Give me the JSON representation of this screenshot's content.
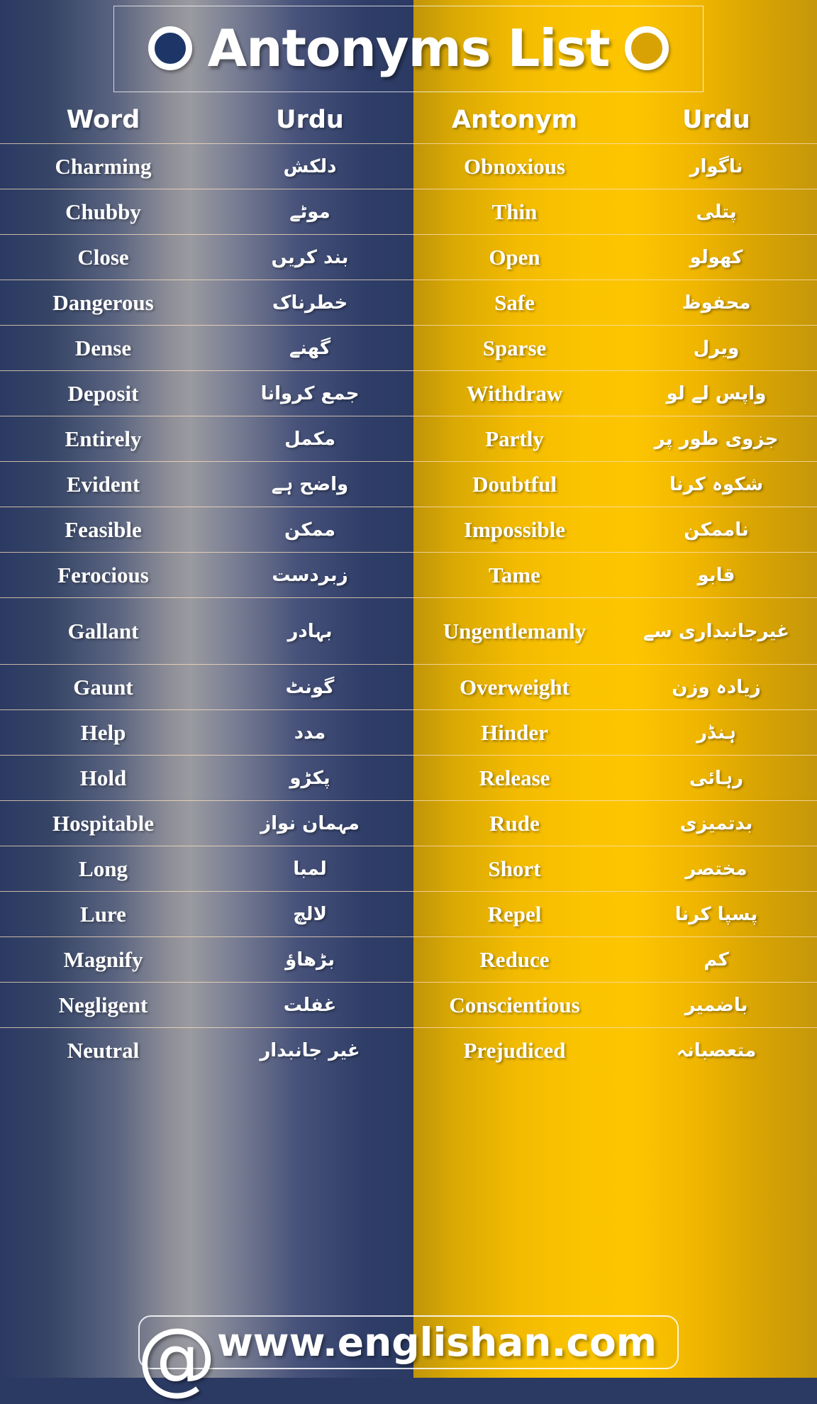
{
  "title": {
    "text": "Antonyms List",
    "left_dot": "circle-icon",
    "right_dot": "circle-icon"
  },
  "colors": {
    "navy": "#2b3a63",
    "navy_light": "#9a9aa0",
    "gold": "#fcc500",
    "gold_dark": "#c1940a",
    "text": "#ffffff",
    "rule": "#ffe1be"
  },
  "table": {
    "headers": [
      "Word",
      "Urdu",
      "Antonym",
      "Urdu"
    ],
    "rows": [
      {
        "word": "Charming",
        "word_urdu": "دلکش",
        "antonym": "Obnoxious",
        "antonym_urdu": "ناگوار"
      },
      {
        "word": "Chubby",
        "word_urdu": "موٹے",
        "antonym": "Thin",
        "antonym_urdu": "پتلی"
      },
      {
        "word": "Close",
        "word_urdu": "بند کریں",
        "antonym": "Open",
        "antonym_urdu": "کھولو"
      },
      {
        "word": "Dangerous",
        "word_urdu": "خطرناک",
        "antonym": "Safe",
        "antonym_urdu": "محفوظ"
      },
      {
        "word": "Dense",
        "word_urdu": "گھنے",
        "antonym": "Sparse",
        "antonym_urdu": "ویرل"
      },
      {
        "word": "Deposit",
        "word_urdu": "جمع کروانا",
        "antonym": "Withdraw",
        "antonym_urdu": "واپس لے لو"
      },
      {
        "word": "Entirely",
        "word_urdu": "مکمل",
        "antonym": "Partly",
        "antonym_urdu": "جزوی طور پر"
      },
      {
        "word": "Evident",
        "word_urdu": "واضح ہے",
        "antonym": "Doubtful",
        "antonym_urdu": "شکوہ کرنا"
      },
      {
        "word": "Feasible",
        "word_urdu": "ممکن",
        "antonym": "Impossible",
        "antonym_urdu": "ناممکن"
      },
      {
        "word": "Ferocious",
        "word_urdu": "زبردست",
        "antonym": "Tame",
        "antonym_urdu": "قابو"
      },
      {
        "word": "Gallant",
        "word_urdu": "بہادر",
        "antonym": "Ungentlemanly",
        "antonym_urdu": "غیرجانبداری سے",
        "tall": true
      },
      {
        "word": "Gaunt",
        "word_urdu": "گونٹ",
        "antonym": "Overweight",
        "antonym_urdu": "زیادہ وزن"
      },
      {
        "word": "Help",
        "word_urdu": "مدد",
        "antonym": "Hinder",
        "antonym_urdu": "ہنڈر"
      },
      {
        "word": "Hold",
        "word_urdu": "پکڑو",
        "antonym": "Release",
        "antonym_urdu": "رہائی"
      },
      {
        "word": "Hospitable",
        "word_urdu": "مہمان نواز",
        "antonym": "Rude",
        "antonym_urdu": "بدتمیزی"
      },
      {
        "word": "Long",
        "word_urdu": "لمبا",
        "antonym": "Short",
        "antonym_urdu": "مختصر"
      },
      {
        "word": "Lure",
        "word_urdu": "لالچ",
        "antonym": "Repel",
        "antonym_urdu": "پسپا کرنا"
      },
      {
        "word": "Magnify",
        "word_urdu": "بڑھاؤ",
        "antonym": "Reduce",
        "antonym_urdu": "کم"
      },
      {
        "word": "Negligent",
        "word_urdu": "غفلت",
        "antonym": "Conscientious",
        "antonym_urdu": "باضمیر"
      },
      {
        "word": "Neutral",
        "word_urdu": "غیر جانبدار",
        "antonym": "Prejudiced",
        "antonym_urdu": "متعصبانہ"
      }
    ]
  },
  "footer": {
    "icon": "at-sign-icon",
    "at_glyph": "@",
    "website": "www.englishan.com"
  }
}
